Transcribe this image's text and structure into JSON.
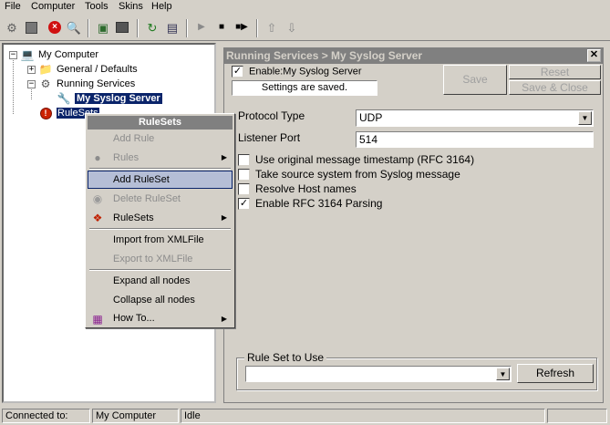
{
  "menubar": {
    "items": [
      "File",
      "Computer",
      "Tools",
      "Skins",
      "Help"
    ]
  },
  "toolbar": {
    "icons": [
      "gear-icon",
      "save-disk-icon",
      "stop-red-icon",
      "search-computer-icon",
      "network-icon",
      "monitor-icon",
      "refresh-icon",
      "document-icon",
      "play-icon",
      "stop-icon",
      "step-icon",
      "up-arrow-icon",
      "down-arrow-icon"
    ]
  },
  "tree": {
    "root": "My Computer",
    "general": "General / Defaults",
    "running_services": "Running Services",
    "syslog_server": "My Syslog Server",
    "rulesets": "RuleSets"
  },
  "panel": {
    "breadcrumb": "Running Services > My Syslog Server",
    "enable_label": "Enable:My Syslog Server",
    "enable_checked": true,
    "status": "Settings are saved.",
    "save": "Save",
    "reset": "Reset",
    "save_close": "Save & Close",
    "protocol_label": "Protocol Type",
    "protocol_value": "UDP",
    "port_label": "Listener Port",
    "port_value": "514",
    "options": [
      {
        "label": "Use original message timestamp (RFC 3164)",
        "checked": false
      },
      {
        "label": "Take source system from Syslog message",
        "checked": false
      },
      {
        "label": "Resolve Host names",
        "checked": false
      },
      {
        "label": "Enable RFC 3164 Parsing",
        "checked": true
      }
    ],
    "ruleset_group": "Rule Set to Use",
    "ruleset_value": "",
    "refresh": "Refresh"
  },
  "context_menu": {
    "title": "RuleSets",
    "items": [
      {
        "label": "Add Rule",
        "enabled": false,
        "icon": "",
        "submenu": false
      },
      {
        "label": "Rules",
        "enabled": false,
        "icon": "rules-icon",
        "submenu": true
      },
      {
        "label": "Add RuleSet",
        "enabled": true,
        "icon": "",
        "submenu": false,
        "highlighted": true
      },
      {
        "label": "Delete RuleSet",
        "enabled": false,
        "icon": "delete-disc-icon",
        "submenu": false
      },
      {
        "label": "RuleSets",
        "enabled": true,
        "icon": "rulesets-icon",
        "submenu": true
      },
      {
        "label": "Import from XMLFile",
        "enabled": true,
        "icon": "",
        "submenu": false
      },
      {
        "label": "Export to XMLFile",
        "enabled": false,
        "icon": "",
        "submenu": false
      },
      {
        "label": "Expand all nodes",
        "enabled": true,
        "icon": "",
        "submenu": false
      },
      {
        "label": "Collapse all nodes",
        "enabled": true,
        "icon": "",
        "submenu": false
      },
      {
        "label": "How To...",
        "enabled": true,
        "icon": "book-icon",
        "submenu": true
      }
    ]
  },
  "statusbar": {
    "label": "Connected to:",
    "computer": "My Computer",
    "state": "Idle"
  },
  "colors": {
    "face": "#d4d0c8",
    "selection": "#0a246a",
    "menu_highlight": "#b5bed6",
    "title_gray": "#808080"
  }
}
